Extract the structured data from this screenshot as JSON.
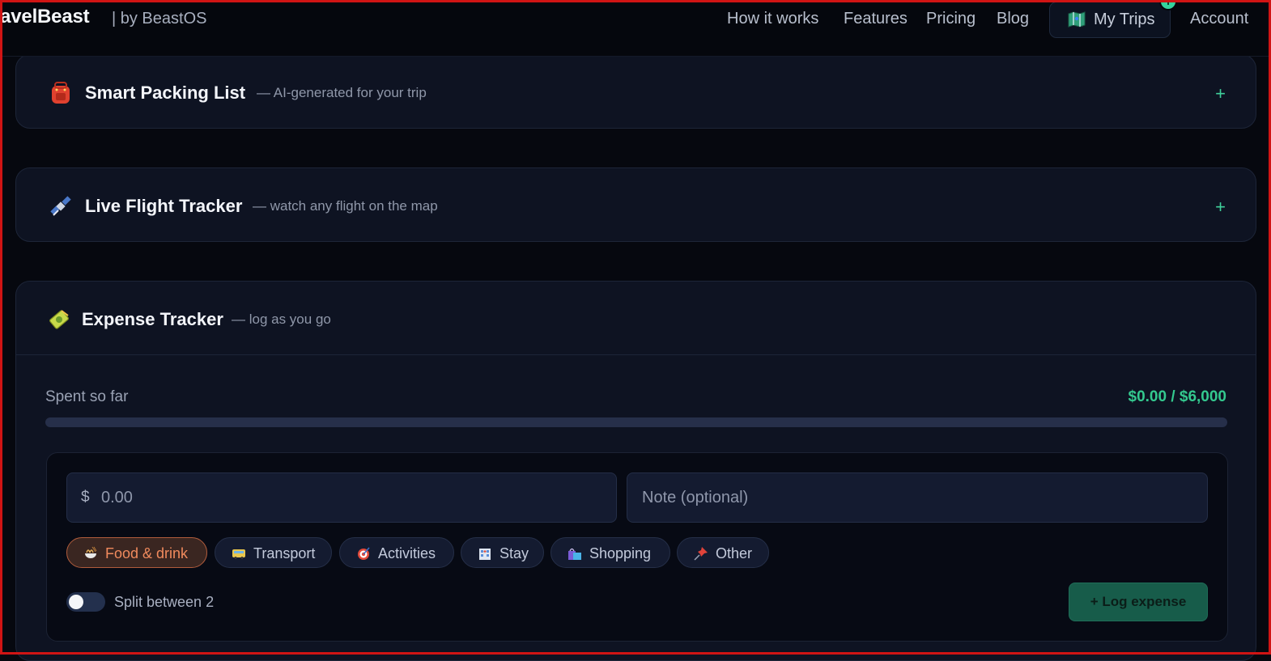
{
  "nav": {
    "brand": "ravelBeast",
    "brand_sub": "| by BeastOS",
    "links": [
      "How it works",
      "Features",
      "Pricing",
      "Blog"
    ],
    "my_trips": "My Trips",
    "account": "Account"
  },
  "cards": {
    "packing": {
      "title": "Smart Packing List",
      "subtitle": "— AI-generated for your trip",
      "toggle": "+",
      "icon": "backpack-icon"
    },
    "flight": {
      "title": "Live Flight Tracker",
      "subtitle": "— watch any flight on the map",
      "toggle": "+",
      "icon": "satellite-icon"
    },
    "expense": {
      "title": "Expense Tracker",
      "subtitle": "— log as you go",
      "icon": "money-icon"
    }
  },
  "expense": {
    "spent_label": "Spent so far",
    "spent_value": "$0.00 / $6,000",
    "progress": 0,
    "currency_symbol": "$",
    "amount_placeholder": "0.00",
    "note_placeholder": "Note (optional)",
    "categories": [
      {
        "label": "Food & drink",
        "icon": "noodles-icon",
        "active": true
      },
      {
        "label": "Transport",
        "icon": "bus-icon",
        "active": false
      },
      {
        "label": "Activities",
        "icon": "target-icon",
        "active": false
      },
      {
        "label": "Stay",
        "icon": "hotel-icon",
        "active": false
      },
      {
        "label": "Shopping",
        "icon": "shopping-bags-icon",
        "active": false
      },
      {
        "label": "Other",
        "icon": "pushpin-icon",
        "active": false
      }
    ],
    "split_label": "Split between 2",
    "log_button": "+ Log expense"
  },
  "colors": {
    "accent": "#34c98f",
    "active_chip": "#f08a5d",
    "background": "#06080f",
    "card": "#0e1322"
  }
}
